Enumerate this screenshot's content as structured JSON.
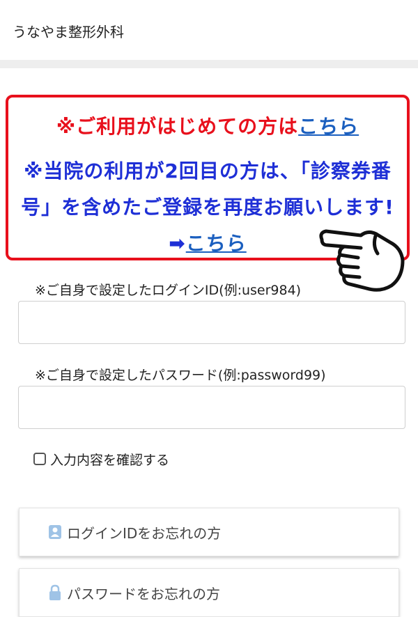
{
  "header": {
    "title": "うなやま整形外科"
  },
  "notice": {
    "line1_text": "※ご利用がはじめての方は",
    "line1_link": "こちら",
    "line2_text": "※当院の利用が2回目の方は、「診察券番号」を含めたご登録を再度お願いします! ➡",
    "line2_link": "こちら",
    "colors": {
      "border": "#e8101c",
      "red": "#e8101c",
      "blue": "#1e2fd6",
      "link": "#1b5fbf"
    }
  },
  "login": {
    "id_label": "※ご自身で設定したログインID(例:user984)",
    "id_value": "",
    "password_label": "※ご自身で設定したパスワード(例:password99)",
    "password_value": ""
  },
  "confirm": {
    "label": "入力内容を確認する",
    "checked": false
  },
  "buttons": {
    "forgot_id": {
      "label": "ログインIDをお忘れの方",
      "icon": "id-card-icon"
    },
    "forgot_password": {
      "label": "パスワードをお忘れの方",
      "icon": "lock-icon"
    }
  }
}
